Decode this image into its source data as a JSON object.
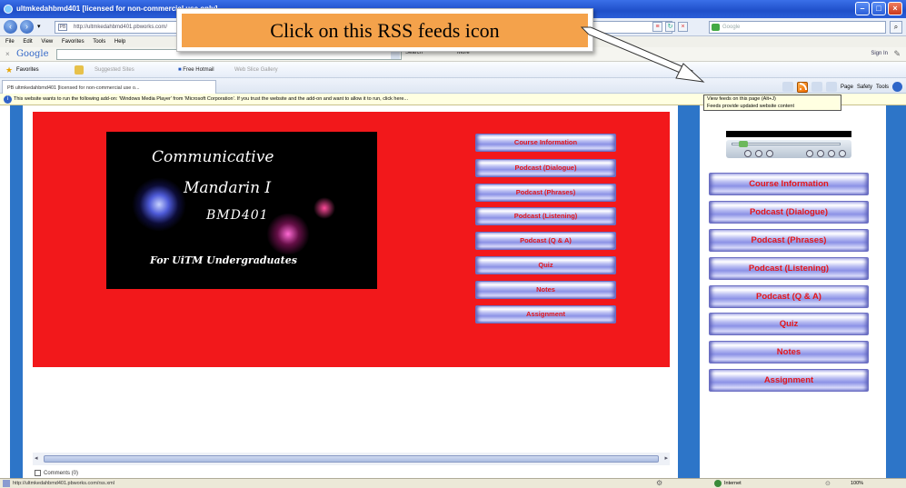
{
  "window": {
    "title": "ultmkedahbmd401 [licensed for non-commercial use only]"
  },
  "address": {
    "url": "http://ultmkedahbmd401.pbworks.com/",
    "live_search_placeholder": "Google"
  },
  "menu": [
    "File",
    "Edit",
    "View",
    "Favorites",
    "Tools",
    "Help"
  ],
  "google_bar": {
    "logo": "Google",
    "search_label": "Search",
    "more_label": "More",
    "sign_in": "Sign In"
  },
  "favorites_bar": {
    "favorites_label": "Favorites",
    "suggested_sites": "Suggested Sites",
    "free_hotmail": "Free Hotmail",
    "web_slice": "Web Slice Gallery"
  },
  "tab": {
    "label": "PB ultmkedahbmd401 [licensed for non-commercial use o..."
  },
  "command_bar": {
    "page": "Page",
    "safety": "Safety",
    "tools": "Tools"
  },
  "info_bar": {
    "text": "This website wants to run the following add-on: 'Windows Media Player' from 'Microsoft Corporation'. If you trust the website and the add-on and want to allow it to run, click here..."
  },
  "tooltip": {
    "line1": "View feeds on this page (Alt+J)",
    "line2": "Feeds provide updated website content"
  },
  "logo": {
    "line1": "Communicative",
    "line2": "Mandarin I",
    "line3": "BMD401",
    "line4": "For UiTM Undergraduates"
  },
  "nav_buttons": [
    "Course Information",
    "Podcast (Dialogue)",
    "Podcast (Phrases)",
    "Podcast (Listening)",
    "Podcast (Q & A)",
    "Quiz",
    "Notes",
    "Assignment"
  ],
  "comments_label": "Comments (0)",
  "status": {
    "url": "http://ultmkedahbmd401.pbworks.com/rss.xml",
    "zone": "Internet",
    "zoom": "100%"
  },
  "callout": {
    "text": "Click on this RSS feeds icon"
  },
  "colors": {
    "panel_red": "#f2181b",
    "side_blue": "#2d75c8",
    "callout_orange": "#f4a24b",
    "button_text_red": "#e4161a"
  }
}
